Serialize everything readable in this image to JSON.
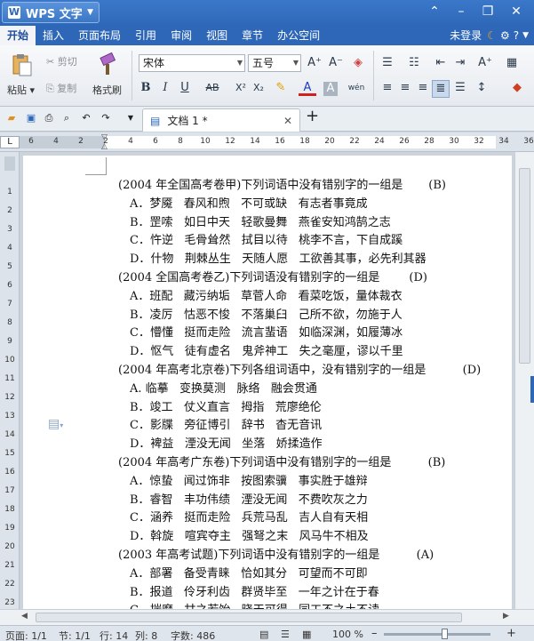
{
  "app": {
    "name": "WPS 文字",
    "colors": {
      "brand_blue": "#2e67b8",
      "accent_orange": "#f0a020"
    }
  },
  "menubar": {
    "tabs": [
      "开始",
      "插入",
      "页面布局",
      "引用",
      "审阅",
      "视图",
      "章节",
      "办公空间"
    ],
    "login_label": "未登录",
    "help_label": "?"
  },
  "ribbon": {
    "paste_label": "粘贴",
    "cut_label": "剪切",
    "copy_label": "复制",
    "format_painter_label": "格式刷",
    "font_name": "宋体",
    "font_size": "五号",
    "bold": "B",
    "italic": "I",
    "underline": "U",
    "strikethrough": "AB",
    "superscript": "X²",
    "subscript": "X₂",
    "font_color": "A",
    "phonetic": "wén"
  },
  "document_tab": {
    "title": "文档 1 *"
  },
  "ruler": {
    "h_ticks": [
      "6",
      "4",
      "2",
      "2",
      "4",
      "6",
      "8",
      "10",
      "12",
      "14",
      "16",
      "18",
      "20",
      "22",
      "24",
      "26",
      "28",
      "30",
      "32",
      "34",
      "36",
      "38"
    ],
    "v_ticks": [
      "1",
      "2",
      "3",
      "4",
      "5",
      "6",
      "7",
      "8",
      "9",
      "10",
      "11",
      "12",
      "13",
      "14",
      "15",
      "16",
      "17",
      "18",
      "19",
      "20",
      "21",
      "22",
      "23"
    ]
  },
  "document": {
    "lines": [
      "(2004 年全国高考卷甲)下列词语中没有错别字的一组是       (B)",
      "A．梦魇   春风和煦   不可或缺   有志者事竟成",
      "B．罡嗦   如日中天   轻歌曼舞   燕雀安知鸿鹄之志",
      "C．忤逆   毛骨耸然   拭目以待   桃李不言，下自成蹊",
      "D．什物   荆棘丛生   天随人愿   工欲善其事，必先利其器",
      "(2004 全国高考卷乙)下列词语没有错别字的一组是        (D)",
      "A．班配   藏污纳垢   草菅人命   看菜吃饭，量体裁衣",
      "B．凌厉   怙恶不悛   不落巢臼   己所不欲，勿施于人",
      "C．懵懂   挺而走险   流言蜚语   如临深渊，如履薄冰",
      "D．怄气   徒有虚名   鬼斧神工   失之毫厘，谬以千里",
      "(2004 年高考北京卷)下列各组词语中，没有错别字的一组是          (D)",
      "A. 临摹   变换莫测   脉络   融会贯通",
      "B．竣工   仗义直言   拇指   荒廖绝伦",
      "C．影牒   旁征博引   辞书   杳无音讯",
      "D．裨益   湮没无闻   坐落   娇揉造作",
      "(2004 年高考广东卷)下列词语中没有错别字的一组是          (B)",
      "A．惊蛰   闻过饰非   按图索骥   事实胜于雄辩",
      "B．睿智   丰功伟绩   湮没无闻   不费吹灰之力",
      "C．涵养   挺而走险   兵荒马乱   吉人自有天相",
      "D．斡旋   喧宾夺主   强弩之末   风马牛不相及",
      "(2003 年高考试题)下列词语中没有错别字的一组是          (A)",
      "A．部署   备受青睐   恰如其分   可望而不可即",
      "B．报道   伶牙利齿   群贤毕至   一年之计在于春",
      "C．揣摩   甘之若饴   晓天可得   同工不之土不读"
    ]
  },
  "statusbar": {
    "page": "页面: 1/1",
    "section": "节: 1/1",
    "row": "行: 14",
    "col": "列: 8",
    "word_count": "字数: 486",
    "zoom": "100 %",
    "zoom_level": 1.0
  }
}
